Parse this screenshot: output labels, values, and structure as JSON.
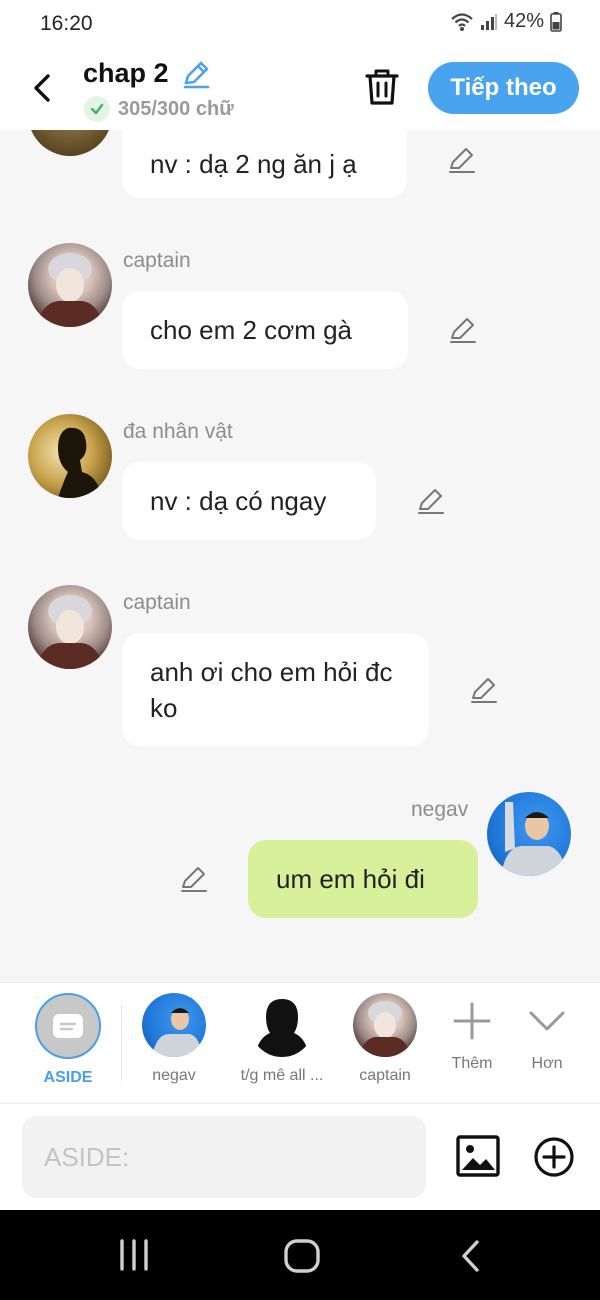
{
  "status": {
    "time": "16:20",
    "battery": "42%"
  },
  "header": {
    "title": "chap 2",
    "word_count": "305/300 chữ",
    "next_label": "Tiếp theo",
    "accent": "#4aa3ee"
  },
  "messages": [
    {
      "speaker": "",
      "text": "nv : dạ 2 ng ăn j ạ",
      "avatar": "dark-sepia-avatar"
    },
    {
      "speaker": "captain",
      "text": "cho em 2 cơm gà",
      "avatar": "captain-avatar"
    },
    {
      "speaker": "đa nhân vật",
      "text": "nv : dạ có ngay",
      "avatar": "silhouette-avatar"
    },
    {
      "speaker": "captain",
      "text": "anh ơi cho em hỏi đc ko",
      "avatar": "captain-avatar"
    },
    {
      "speaker": "negav",
      "text": "um em hỏi đi",
      "avatar": "negav-avatar",
      "mine": true
    }
  ],
  "characters": [
    {
      "label": "ASIDE",
      "selected": true,
      "icon": "aside-icon"
    },
    {
      "label": "negav",
      "icon": "negav-avatar"
    },
    {
      "label": "t/g mê all ...",
      "icon": "silhouette-woman-avatar"
    },
    {
      "label": "captain",
      "icon": "captain-avatar"
    },
    {
      "label": "Thêm",
      "icon": "plus-icon"
    },
    {
      "label": "Hơn",
      "icon": "chevron-down-icon"
    }
  ],
  "input": {
    "placeholder": "ASIDE:"
  },
  "colors": {
    "my_bubble": "#d9f09a",
    "other_bubble": "#ffffff",
    "selected_tab": "#4a9ee8"
  }
}
